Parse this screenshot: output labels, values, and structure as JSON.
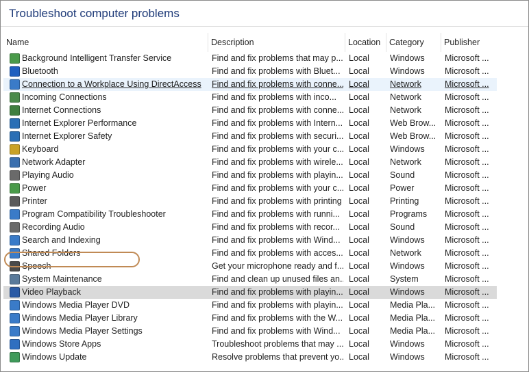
{
  "window": {
    "title": "Troubleshoot computer problems"
  },
  "columns": [
    "Name",
    "Description",
    "Location",
    "Category",
    "Publisher"
  ],
  "rows": [
    {
      "name": "Background Intelligent Transfer Service",
      "description": "Find and fix problems that may p...",
      "location": "Local",
      "category": "Windows",
      "publisher": "Microsoft ...",
      "icon": "transfer-icon",
      "icon_color": "#4a9a4a"
    },
    {
      "name": "Bluetooth",
      "description": "Find and fix problems with Bluet...",
      "location": "Local",
      "category": "Windows",
      "publisher": "Microsoft ...",
      "icon": "bluetooth-icon",
      "icon_color": "#1f5fbf"
    },
    {
      "name": "Connection to a Workplace Using DirectAccess",
      "description": "Find and fix problems with conne...",
      "location": "Local",
      "category": "Network",
      "publisher": "Microsoft ...",
      "icon": "network-drive-icon",
      "icon_color": "#3a7bc8",
      "state": "hover"
    },
    {
      "name": "Incoming Connections",
      "description": "Find and fix problems with inco...",
      "location": "Local",
      "category": "Network",
      "publisher": "Microsoft ...",
      "icon": "incoming-connections-icon",
      "icon_color": "#4a8a4a"
    },
    {
      "name": "Internet Connections",
      "description": "Find and fix problems with conne...",
      "location": "Local",
      "category": "Network",
      "publisher": "Microsoft ...",
      "icon": "internet-connections-icon",
      "icon_color": "#3f7f3f"
    },
    {
      "name": "Internet Explorer Performance",
      "description": "Find and fix problems with Intern...",
      "location": "Local",
      "category": "Web Brow...",
      "publisher": "Microsoft ...",
      "icon": "ie-performance-icon",
      "icon_color": "#2a6fb5"
    },
    {
      "name": "Internet Explorer Safety",
      "description": "Find and fix problems with securi...",
      "location": "Local",
      "category": "Web Brow...",
      "publisher": "Microsoft ...",
      "icon": "ie-safety-icon",
      "icon_color": "#2a6fb5"
    },
    {
      "name": "Keyboard",
      "description": "Find and fix problems with your c...",
      "location": "Local",
      "category": "Windows",
      "publisher": "Microsoft ...",
      "icon": "keyboard-icon",
      "icon_color": "#c9a227"
    },
    {
      "name": "Network Adapter",
      "description": "Find and fix problems with wirele...",
      "location": "Local",
      "category": "Network",
      "publisher": "Microsoft ...",
      "icon": "network-adapter-icon",
      "icon_color": "#3a6fae"
    },
    {
      "name": "Playing Audio",
      "description": "Find and fix problems with playin...",
      "location": "Local",
      "category": "Sound",
      "publisher": "Microsoft ...",
      "icon": "speaker-icon",
      "icon_color": "#6a6a6a"
    },
    {
      "name": "Power",
      "description": "Find and fix problems with your c...",
      "location": "Local",
      "category": "Power",
      "publisher": "Microsoft ...",
      "icon": "battery-icon",
      "icon_color": "#4a9a4a"
    },
    {
      "name": "Printer",
      "description": "Find and fix problems with printing",
      "location": "Local",
      "category": "Printing",
      "publisher": "Microsoft ...",
      "icon": "printer-icon",
      "icon_color": "#5a5a5a"
    },
    {
      "name": "Program Compatibility Troubleshooter",
      "description": "Find and fix problems with runni...",
      "location": "Local",
      "category": "Programs",
      "publisher": "Microsoft ...",
      "icon": "program-compatibility-icon",
      "icon_color": "#3a7bc8"
    },
    {
      "name": "Recording Audio",
      "description": "Find and fix problems with recor...",
      "location": "Local",
      "category": "Sound",
      "publisher": "Microsoft ...",
      "icon": "microphone-icon",
      "icon_color": "#6a6a6a"
    },
    {
      "name": "Search and Indexing",
      "description": "Find and fix problems with Wind...",
      "location": "Local",
      "category": "Windows",
      "publisher": "Microsoft ...",
      "icon": "search-icon",
      "icon_color": "#3a7bc8"
    },
    {
      "name": "Shared Folders",
      "description": "Find and fix problems with acces...",
      "location": "Local",
      "category": "Network",
      "publisher": "Microsoft ...",
      "icon": "shared-folder-icon",
      "icon_color": "#3a7bc8"
    },
    {
      "name": "Speech",
      "description": "Get your microphone ready and f...",
      "location": "Local",
      "category": "Windows",
      "publisher": "Microsoft ...",
      "icon": "speech-icon",
      "icon_color": "#4a4a4a"
    },
    {
      "name": "System Maintenance",
      "description": "Find and clean up unused files an...",
      "location": "Local",
      "category": "System",
      "publisher": "Microsoft ...",
      "icon": "maintenance-icon",
      "icon_color": "#5a7a9a"
    },
    {
      "name": "Video Playback",
      "description": "Find and fix problems with playin...",
      "location": "Local",
      "category": "Windows",
      "publisher": "Microsoft ...",
      "icon": "video-playback-icon",
      "icon_color": "#2a5aa5",
      "state": "selected"
    },
    {
      "name": "Windows Media Player DVD",
      "description": "Find and fix problems with playin...",
      "location": "Local",
      "category": "Media Pla...",
      "publisher": "Microsoft ...",
      "icon": "media-player-dvd-icon",
      "icon_color": "#3a7bc8"
    },
    {
      "name": "Windows Media Player Library",
      "description": "Find and fix problems with the W...",
      "location": "Local",
      "category": "Media Pla...",
      "publisher": "Microsoft ...",
      "icon": "media-player-library-icon",
      "icon_color": "#3a7bc8"
    },
    {
      "name": "Windows Media Player Settings",
      "description": "Find and fix problems with Wind...",
      "location": "Local",
      "category": "Media Pla...",
      "publisher": "Microsoft ...",
      "icon": "media-player-settings-icon",
      "icon_color": "#3a7bc8"
    },
    {
      "name": "Windows Store Apps",
      "description": "Troubleshoot problems that may ...",
      "location": "Local",
      "category": "Windows",
      "publisher": "Microsoft ...",
      "icon": "store-apps-icon",
      "icon_color": "#2f6fc0"
    },
    {
      "name": "Windows Update",
      "description": "Resolve problems that prevent yo...",
      "location": "Local",
      "category": "Windows",
      "publisher": "Microsoft ...",
      "icon": "windows-update-icon",
      "icon_color": "#3f9a5a"
    }
  ]
}
